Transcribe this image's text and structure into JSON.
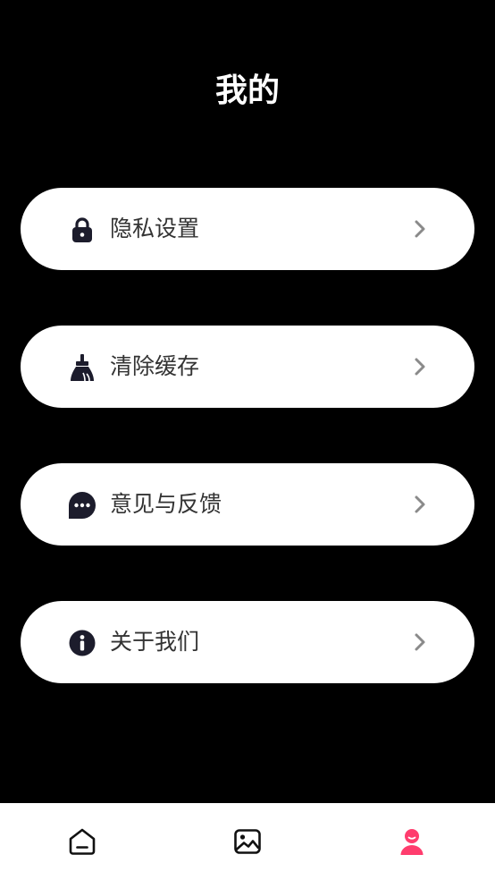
{
  "header": {
    "title": "我的"
  },
  "menu": {
    "items": [
      {
        "label": "隐私设置",
        "icon": "lock-icon"
      },
      {
        "label": "清除缓存",
        "icon": "broom-icon"
      },
      {
        "label": "意见与反馈",
        "icon": "chat-bubble-icon"
      },
      {
        "label": "关于我们",
        "icon": "info-icon"
      }
    ],
    "trailing_icon": "chevron-right-icon"
  },
  "tab_bar": {
    "tabs": [
      {
        "icon": "home-icon",
        "active": false
      },
      {
        "icon": "image-icon",
        "active": false
      },
      {
        "icon": "profile-icon",
        "active": true
      }
    ]
  },
  "colors": {
    "background": "#000000",
    "card": "#ffffff",
    "icon_dark": "#1c1c2c",
    "chevron": "#8a8a8a",
    "active_tab": "#ff3d6e"
  }
}
